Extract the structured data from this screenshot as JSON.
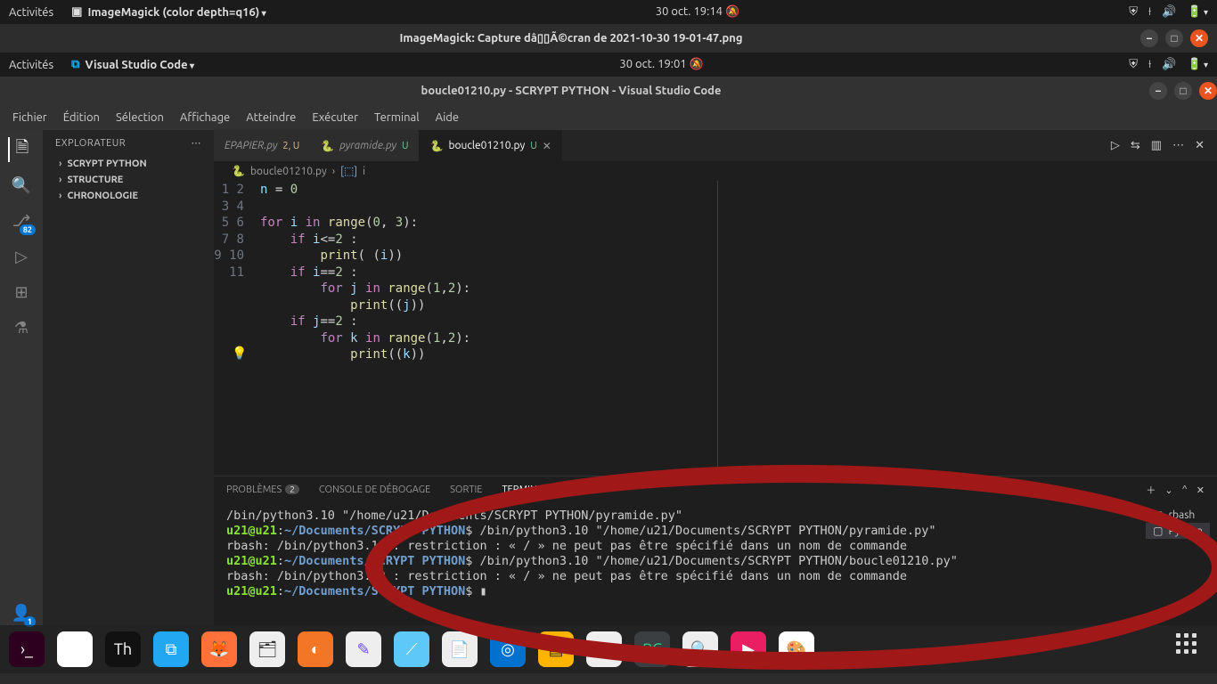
{
  "outer_topbar": {
    "activities": "Activités",
    "app_name": "ImageMagick (color depth=q16)",
    "datetime": "30 oct.  19:14"
  },
  "image_window_title": "ImageMagick: Capture dâ▯▯Ã©cran de 2021-10-30 19-01-47.png",
  "inner_topbar": {
    "activities": "Activités",
    "app_name": "Visual Studio Code",
    "datetime": "30 oct.  19:01"
  },
  "vscode_title": "boucle01210.py - SCRYPT PYTHON - Visual Studio Code",
  "menubar": [
    "Fichier",
    "Édition",
    "Sélection",
    "Affichage",
    "Atteindre",
    "Exécuter",
    "Terminal",
    "Aide"
  ],
  "activity_badge": "82",
  "account_badge": "1",
  "sidebar": {
    "title": "EXPLORATEUR",
    "items": [
      "SCRYPT PYTHON",
      "STRUCTURE",
      "CHRONOLOGIE"
    ]
  },
  "tabs": [
    {
      "label": "EPAPIER.py",
      "git": "2, U",
      "git_class": "git-m"
    },
    {
      "label": "pyramide.py",
      "git": "U",
      "git_class": "git-u"
    },
    {
      "label": "boucle01210.py",
      "git": "U",
      "git_class": "git-u",
      "active": true,
      "close": true
    }
  ],
  "breadcrumb": {
    "file": "boucle01210.py",
    "symbol": "i"
  },
  "code_lines": [
    "n = 0",
    "",
    "for i in range(0, 3):",
    "    if i<=2 :",
    "        print( (i))",
    "    if i==2 :",
    "        for j in range(1,2):",
    "            print((j))",
    "    if j==2 :",
    "        for k in range(1,2):",
    "            print((k))"
  ],
  "panel": {
    "tabs": [
      {
        "label": "PROBLÈMES",
        "badge": "2"
      },
      {
        "label": "CONSOLE DE DÉBOGAGE"
      },
      {
        "label": "SORTIE"
      },
      {
        "label": "TERMINAL",
        "active": true
      }
    ],
    "terminals": [
      {
        "name": "rbash"
      },
      {
        "name": "Python",
        "selected": true
      }
    ]
  },
  "terminal_lines": [
    {
      "t": "plain",
      "text": "/bin/python3.10 \"/home/u21/Documents/SCRYPT PYTHON/pyramide.py\""
    },
    {
      "t": "prompt",
      "user": "u21@u21",
      "path": "~/Documents/SCRYPT PYTHON",
      "rest": "$ /bin/python3.10 \"/home/u21/Documents/SCRYPT PYTHON/pyramide.py\""
    },
    {
      "t": "plain",
      "text": "rbash: /bin/python3.10 : restriction : « / » ne peut pas être spécifié dans un nom de commande"
    },
    {
      "t": "prompt",
      "user": "u21@u21",
      "path": "~/Documents/SCRYPT PYTHON",
      "rest": "$ /bin/python3.10 \"/home/u21/Documents/SCRYPT PYTHON/boucle01210.py\""
    },
    {
      "t": "plain",
      "text": "rbash: /bin/python3.10 : restriction : « / » ne peut pas être spécifié dans un nom de commande"
    },
    {
      "t": "prompt",
      "user": "u21@u21",
      "path": "~/Documents/SCRYPT PYTHON",
      "rest": "$ ▮"
    }
  ]
}
